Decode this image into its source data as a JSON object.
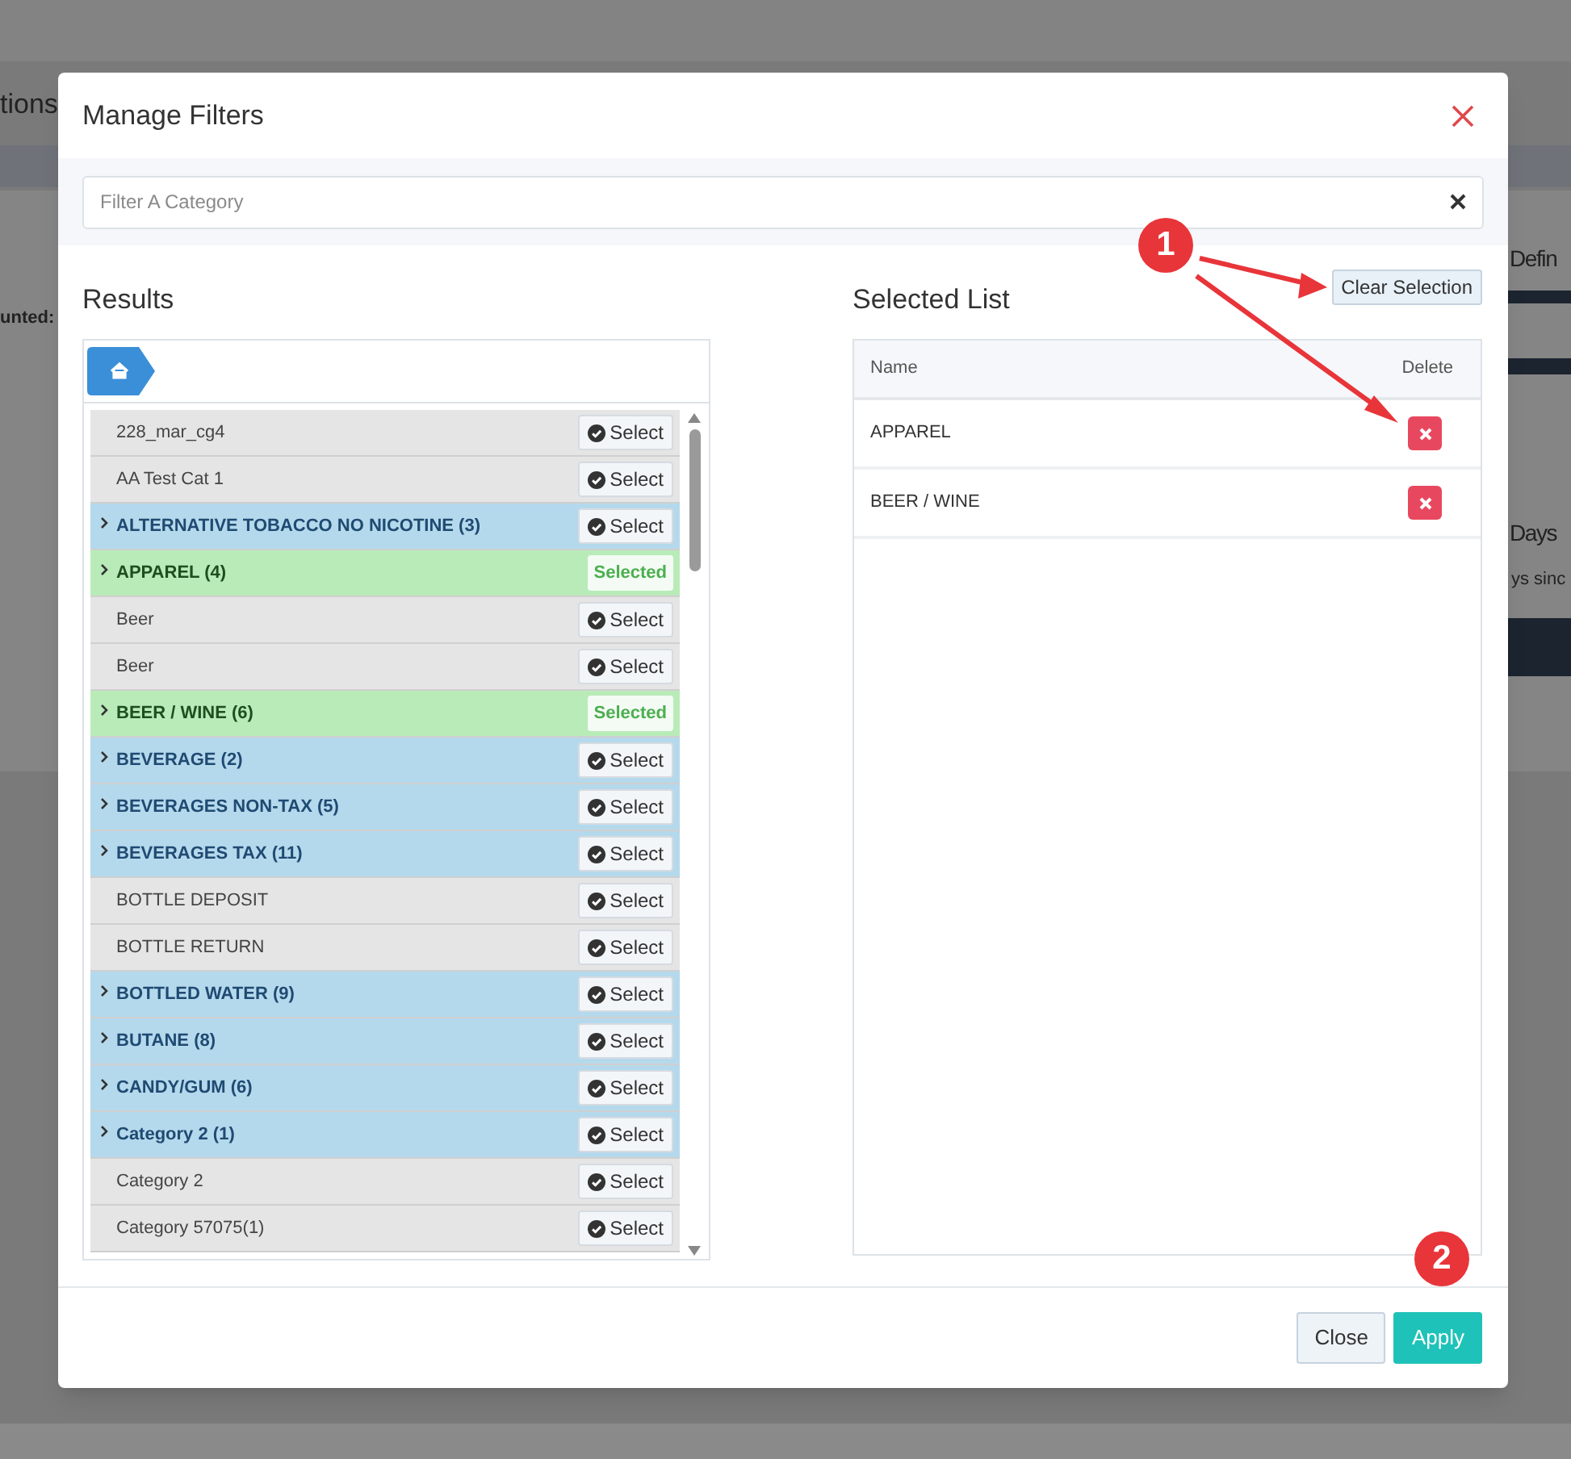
{
  "background": {
    "fragments": [
      {
        "text": "tions"
      },
      {
        "text": "unted:"
      },
      {
        "text": "Defin"
      },
      {
        "text": "Days"
      },
      {
        "text": "ys sinc"
      }
    ]
  },
  "modal": {
    "title": "Manage Filters",
    "search": {
      "placeholder": "Filter A Category"
    },
    "results": {
      "title": "Results",
      "items": [
        {
          "name": "228_mar_cg4",
          "kind": "leaf",
          "selected": false,
          "action": "Select"
        },
        {
          "name": "AA Test Cat 1",
          "kind": "leaf",
          "selected": false,
          "action": "Select"
        },
        {
          "name": "ALTERNATIVE TOBACCO NO NICOTINE (3)",
          "kind": "group",
          "selected": false,
          "action": "Select"
        },
        {
          "name": "APPAREL (4)",
          "kind": "group",
          "selected": true,
          "action": "Selected"
        },
        {
          "name": "Beer",
          "kind": "leaf",
          "selected": false,
          "action": "Select"
        },
        {
          "name": "Beer",
          "kind": "leaf",
          "selected": false,
          "action": "Select"
        },
        {
          "name": "BEER / WINE (6)",
          "kind": "group",
          "selected": true,
          "action": "Selected"
        },
        {
          "name": "BEVERAGE (2)",
          "kind": "group",
          "selected": false,
          "action": "Select"
        },
        {
          "name": "BEVERAGES NON-TAX (5)",
          "kind": "group",
          "selected": false,
          "action": "Select"
        },
        {
          "name": "BEVERAGES TAX (11)",
          "kind": "group",
          "selected": false,
          "action": "Select"
        },
        {
          "name": "BOTTLE DEPOSIT",
          "kind": "leaf",
          "selected": false,
          "action": "Select"
        },
        {
          "name": "BOTTLE RETURN",
          "kind": "leaf",
          "selected": false,
          "action": "Select"
        },
        {
          "name": "BOTTLED WATER (9)",
          "kind": "group",
          "selected": false,
          "action": "Select"
        },
        {
          "name": "BUTANE (8)",
          "kind": "group",
          "selected": false,
          "action": "Select"
        },
        {
          "name": "CANDY/GUM (6)",
          "kind": "group",
          "selected": false,
          "action": "Select"
        },
        {
          "name": "Category 2 (1)",
          "kind": "group",
          "selected": false,
          "action": "Select"
        },
        {
          "name": "Category 2",
          "kind": "leaf",
          "selected": false,
          "action": "Select"
        },
        {
          "name": "Category 57075(1)",
          "kind": "leaf",
          "selected": false,
          "action": "Select"
        }
      ]
    },
    "selected_list": {
      "title": "Selected List",
      "clear_button": "Clear Selection",
      "columns": [
        "Name",
        "Delete"
      ],
      "rows": [
        {
          "name": "APPAREL"
        },
        {
          "name": "BEER / WINE"
        }
      ]
    },
    "buttons": [
      {
        "label": "Close",
        "kind": "secondary"
      },
      {
        "label": "Apply",
        "kind": "primary"
      }
    ]
  },
  "annotations": [
    {
      "label": "1"
    },
    {
      "label": "2"
    }
  ]
}
